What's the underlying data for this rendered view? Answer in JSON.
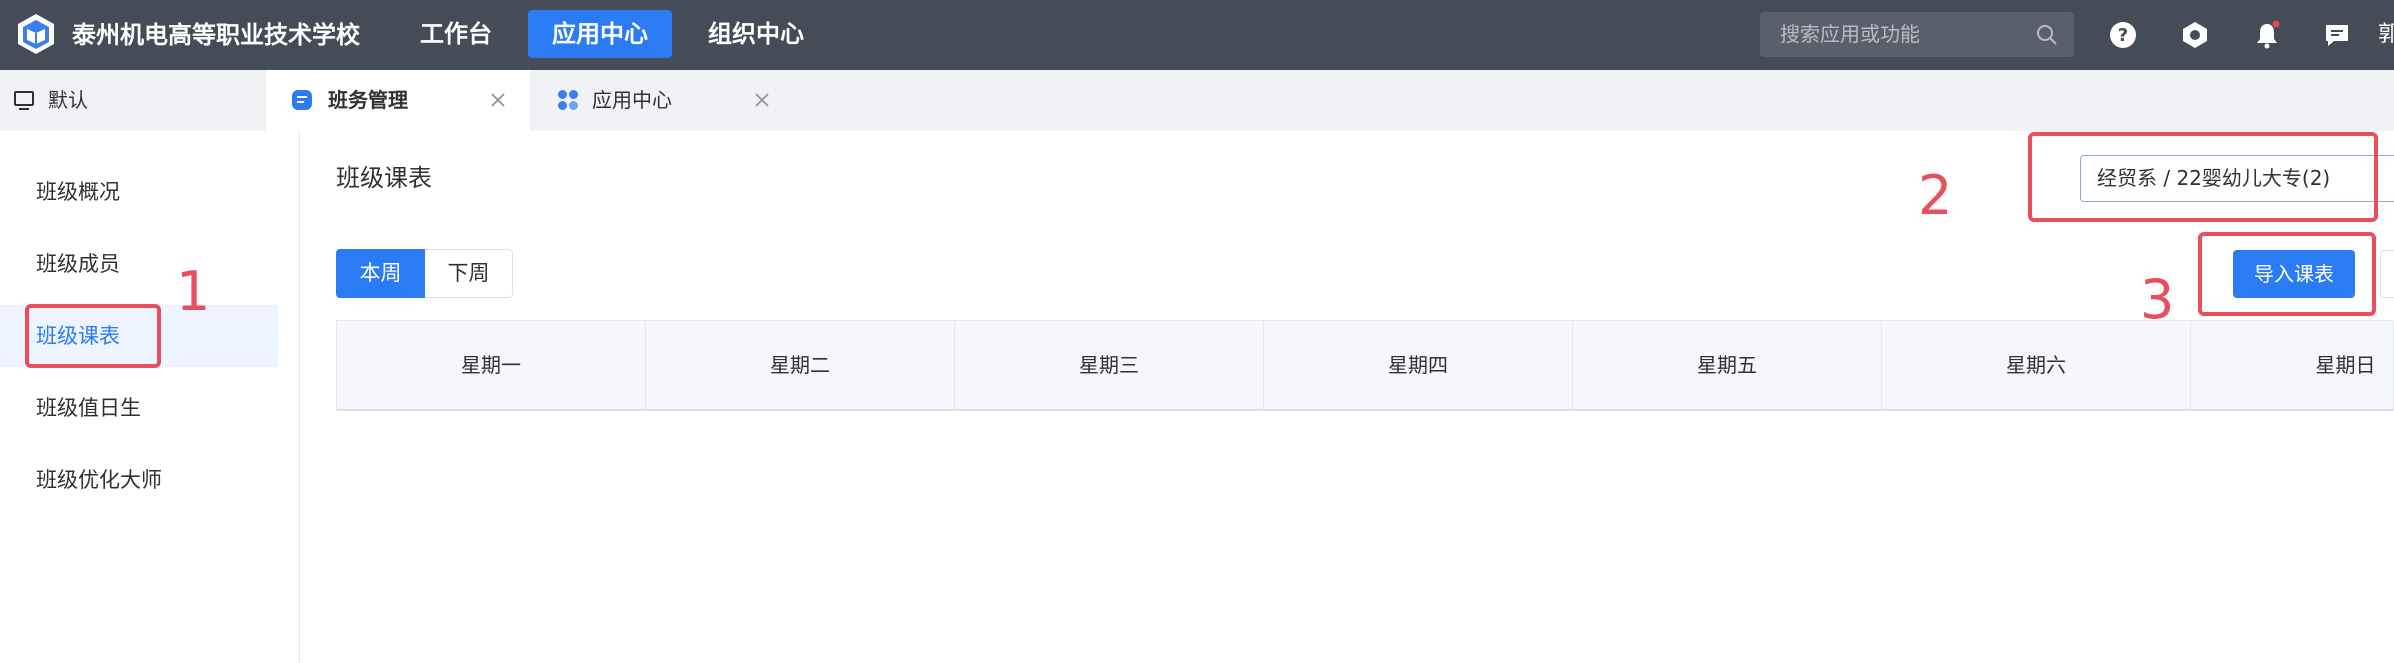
{
  "header": {
    "school_name": "泰州机电高等职业技术学校",
    "nav": [
      {
        "label": "工作台"
      },
      {
        "label": "应用中心",
        "active": true
      },
      {
        "label": "组织中心"
      }
    ],
    "search_placeholder": "搜索应用或功能",
    "user_partial": "郭"
  },
  "tabs": [
    {
      "label": "默认",
      "icon": "monitor-icon"
    },
    {
      "label": "班务管理",
      "icon": "chat-icon",
      "active": true
    },
    {
      "label": "应用中心",
      "icon": "grid-apps-icon"
    }
  ],
  "sidebar": {
    "items": [
      {
        "label": "班级概况"
      },
      {
        "label": "班级成员"
      },
      {
        "label": "班级课表",
        "active": true
      },
      {
        "label": "班级值日生"
      },
      {
        "label": "班级优化大师"
      }
    ]
  },
  "main": {
    "title": "班级课表",
    "class_select_value": "经贸系 / 22婴幼儿大专(2)",
    "week_toggle": [
      "本周",
      "下周"
    ],
    "import_button": "导入课表",
    "weekdays": [
      "星期一",
      "星期二",
      "星期三",
      "星期四",
      "星期五",
      "星期六",
      "星期日"
    ]
  },
  "annotations": [
    "1",
    "2",
    "3"
  ],
  "colors": {
    "topbar": "#464c57",
    "accent": "#2b7bf5",
    "annotation": "#ea4d5c"
  }
}
